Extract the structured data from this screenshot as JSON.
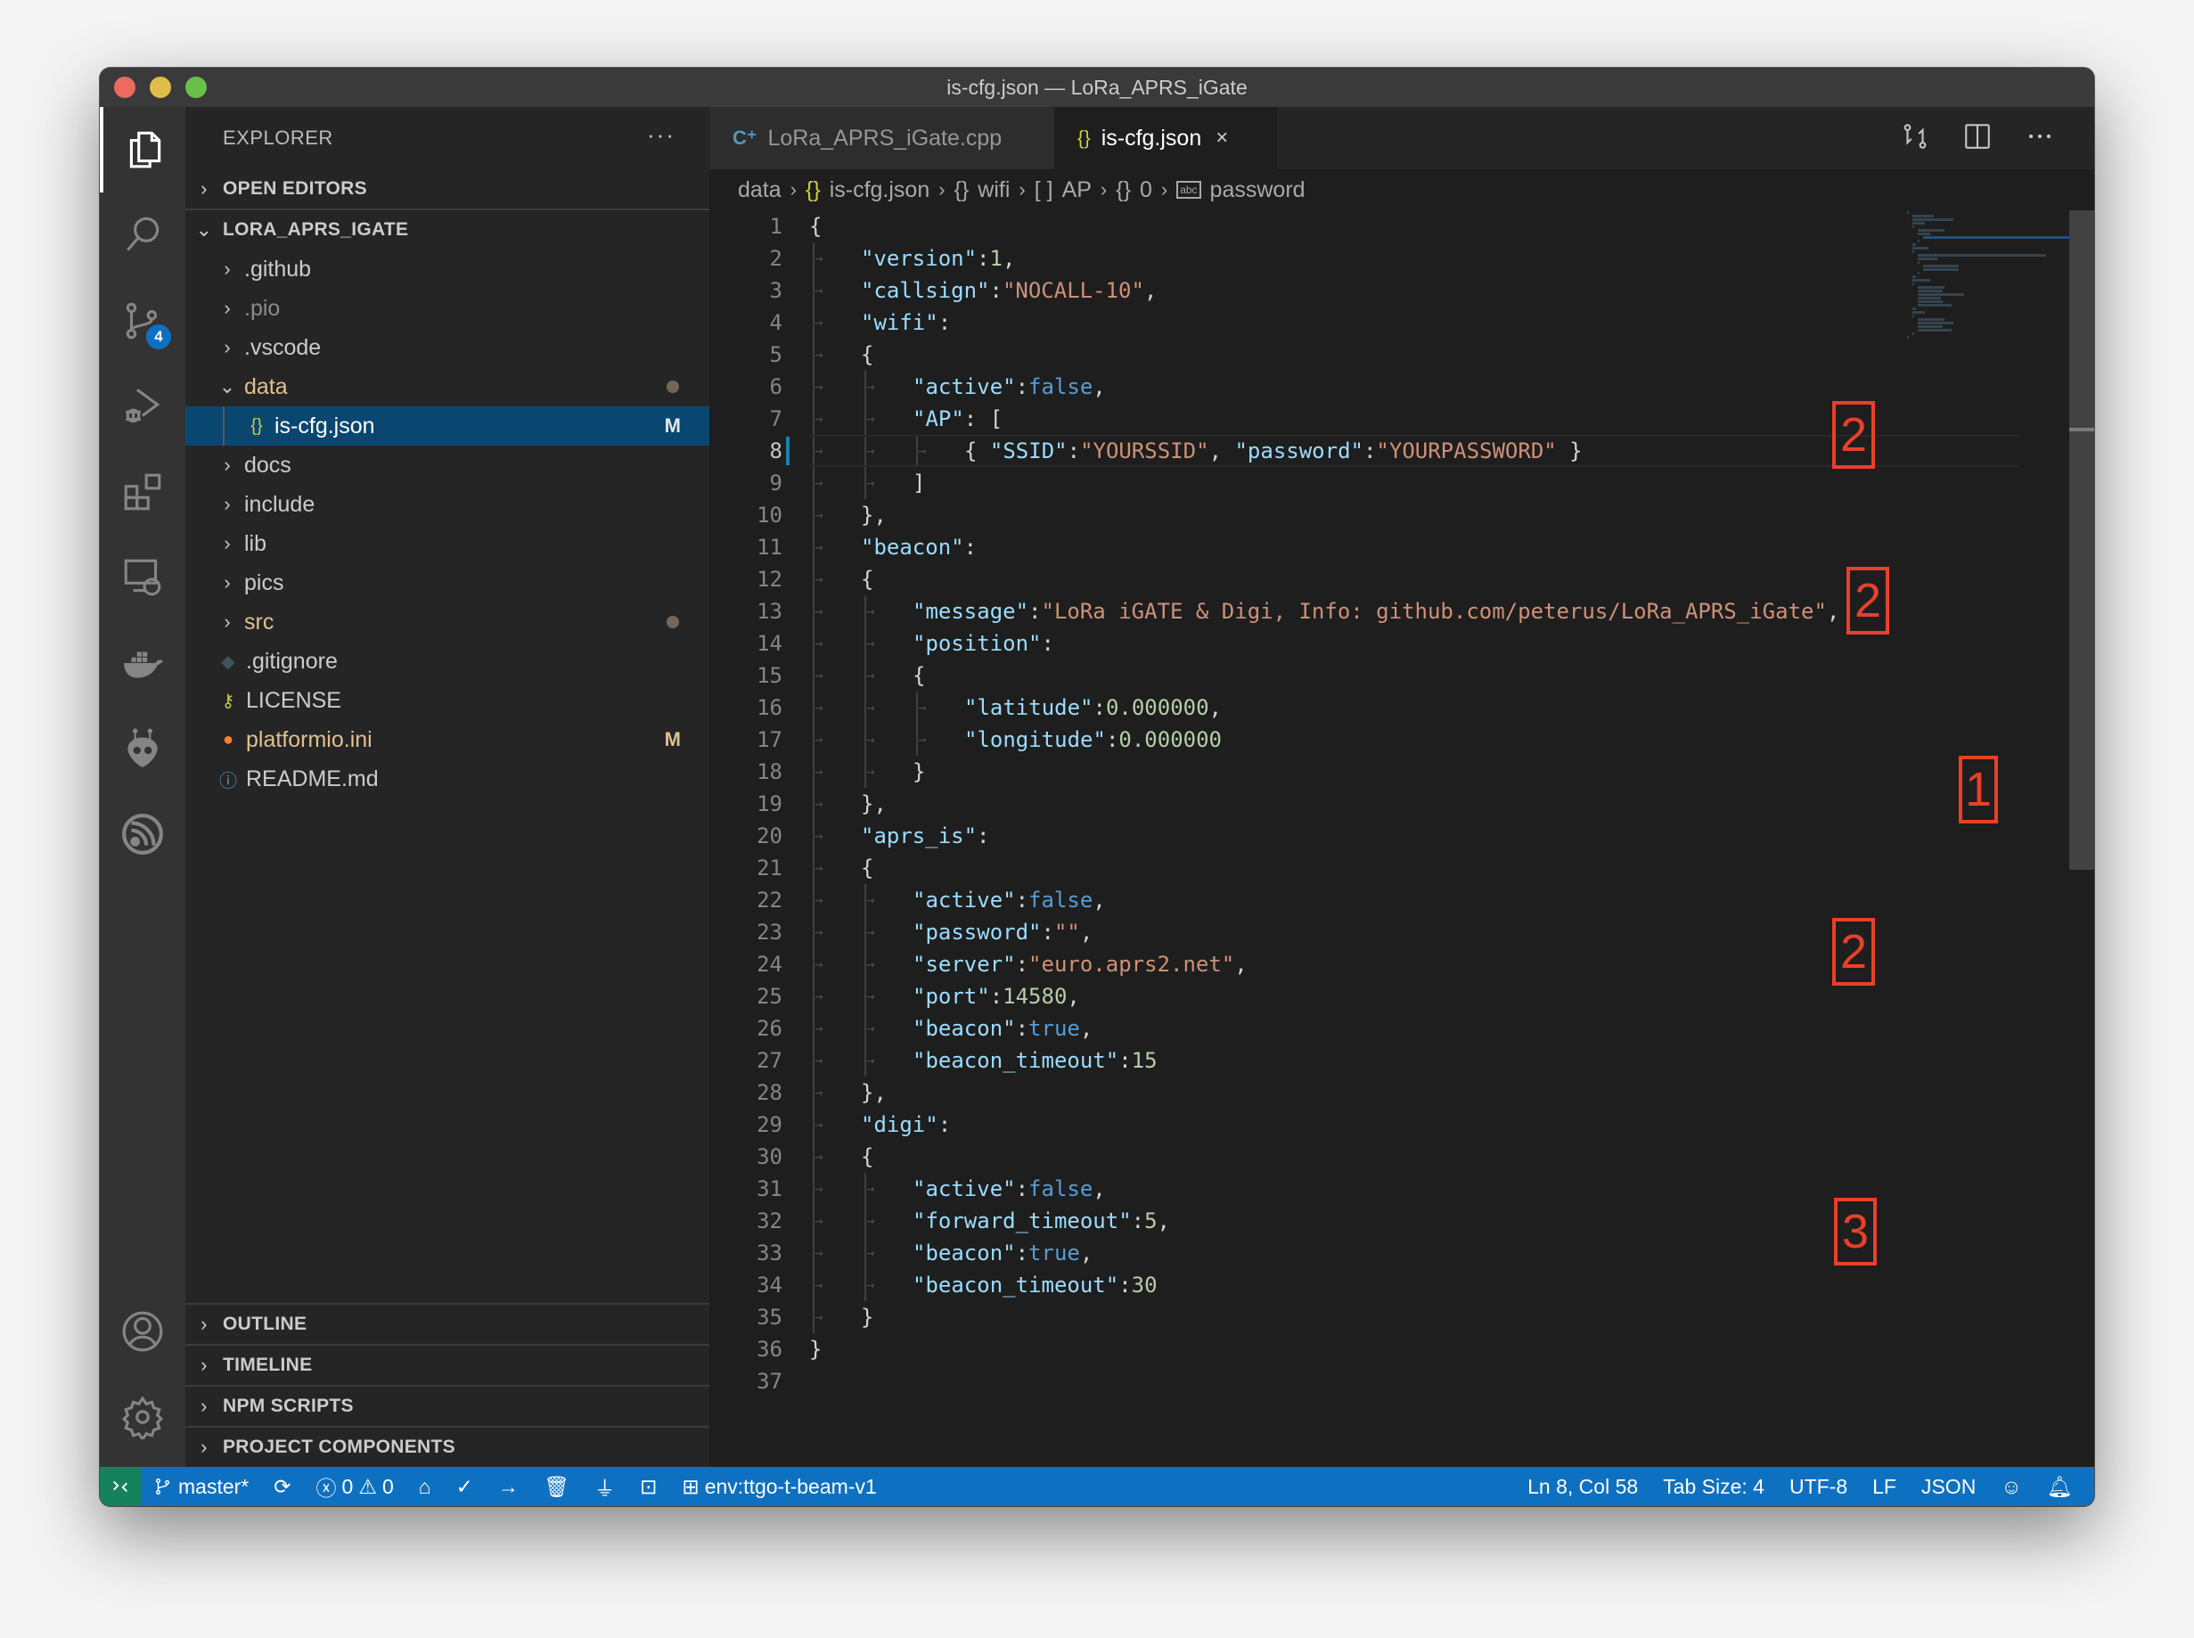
{
  "window": {
    "title": "is-cfg.json — LoRa_APRS_iGate"
  },
  "activity_bar": {
    "items": [
      {
        "name": "explorer",
        "icon": "files-icon",
        "active": true
      },
      {
        "name": "search",
        "icon": "search-icon"
      },
      {
        "name": "source-control",
        "icon": "source-control-icon",
        "badge": "4"
      },
      {
        "name": "run-debug",
        "icon": "run-debug-icon"
      },
      {
        "name": "extensions",
        "icon": "extensions-icon"
      },
      {
        "name": "remote-explorer",
        "icon": "remote-explorer-icon"
      },
      {
        "name": "docker",
        "icon": "docker-icon"
      },
      {
        "name": "platformio",
        "icon": "platformio-icon"
      },
      {
        "name": "espressif",
        "icon": "espressif-icon"
      }
    ],
    "bottom": [
      {
        "name": "accounts",
        "icon": "account-icon"
      },
      {
        "name": "manage",
        "icon": "gear-icon"
      }
    ]
  },
  "sidebar": {
    "title": "EXPLORER",
    "more": "···",
    "open_editors": "OPEN EDITORS",
    "project": "LORA_APRS_IGATE",
    "tree": [
      {
        "label": ".github",
        "type": "folder",
        "expanded": false
      },
      {
        "label": ".pio",
        "type": "folder",
        "expanded": false,
        "dimmed": true
      },
      {
        "label": ".vscode",
        "type": "folder",
        "expanded": false
      },
      {
        "label": "data",
        "type": "folder",
        "expanded": true,
        "modified": true
      },
      {
        "label": "is-cfg.json",
        "type": "file",
        "icon": "{}",
        "selected": true,
        "decoration": "M"
      },
      {
        "label": "docs",
        "type": "folder",
        "expanded": false
      },
      {
        "label": "include",
        "type": "folder",
        "expanded": false
      },
      {
        "label": "lib",
        "type": "folder",
        "expanded": false
      },
      {
        "label": "pics",
        "type": "folder",
        "expanded": false
      },
      {
        "label": "src",
        "type": "folder",
        "expanded": false,
        "modified": true
      },
      {
        "label": ".gitignore",
        "type": "file",
        "icon": "git-icon"
      },
      {
        "label": "LICENSE",
        "type": "file",
        "icon": "license-key-icon"
      },
      {
        "label": "platformio.ini",
        "type": "file",
        "icon": "platformio-file-icon",
        "decoration": "M",
        "modified": true
      },
      {
        "label": "README.md",
        "type": "file",
        "icon": "info-icon"
      }
    ],
    "sections": [
      "OUTLINE",
      "TIMELINE",
      "NPM SCRIPTS",
      "PROJECT COMPONENTS"
    ]
  },
  "tabs": [
    {
      "label": "LoRa_APRS_iGate.cpp",
      "icon": "C++",
      "active": false
    },
    {
      "label": "is-cfg.json",
      "icon": "{}",
      "active": true,
      "close": "×"
    }
  ],
  "breadcrumb": {
    "items": [
      {
        "label": "data",
        "icon": ""
      },
      {
        "label": "is-cfg.json",
        "icon": "{}"
      },
      {
        "label": "wifi",
        "icon": "{}"
      },
      {
        "label": "AP",
        "icon": "[ ]"
      },
      {
        "label": "0",
        "icon": "{}"
      },
      {
        "label": "password",
        "icon": "abc"
      }
    ],
    "separator": "›"
  },
  "editor": {
    "current_line": 8,
    "lines": [
      [
        {
          "t": "p",
          "v": "{"
        }
      ],
      [
        {
          "t": "k",
          "v": "\"version\""
        },
        {
          "t": "p",
          "v": ":"
        },
        {
          "t": "n",
          "v": "1"
        },
        {
          "t": "p",
          "v": ","
        }
      ],
      [
        {
          "t": "k",
          "v": "\"callsign\""
        },
        {
          "t": "p",
          "v": ":"
        },
        {
          "t": "s",
          "v": "\"NOCALL-10\""
        },
        {
          "t": "p",
          "v": ","
        }
      ],
      [
        {
          "t": "k",
          "v": "\"wifi\""
        },
        {
          "t": "p",
          "v": ":"
        }
      ],
      [
        {
          "t": "p",
          "v": "{"
        }
      ],
      [
        {
          "t": "k",
          "v": "\"active\""
        },
        {
          "t": "p",
          "v": ":"
        },
        {
          "t": "b",
          "v": "false"
        },
        {
          "t": "p",
          "v": ","
        }
      ],
      [
        {
          "t": "k",
          "v": "\"AP\""
        },
        {
          "t": "p",
          "v": ": ["
        }
      ],
      [
        {
          "t": "p",
          "v": "{ "
        },
        {
          "t": "k",
          "v": "\"SSID\""
        },
        {
          "t": "p",
          "v": ":"
        },
        {
          "t": "s",
          "v": "\"YOURSSID\""
        },
        {
          "t": "p",
          "v": ", "
        },
        {
          "t": "k",
          "v": "\"password\""
        },
        {
          "t": "p",
          "v": ":"
        },
        {
          "t": "s",
          "v": "\"YOURPASSWORD\""
        },
        {
          "t": "p",
          "v": " }"
        }
      ],
      [
        {
          "t": "p",
          "v": "]"
        }
      ],
      [
        {
          "t": "p",
          "v": "},"
        }
      ],
      [
        {
          "t": "k",
          "v": "\"beacon\""
        },
        {
          "t": "p",
          "v": ":"
        }
      ],
      [
        {
          "t": "p",
          "v": "{"
        }
      ],
      [
        {
          "t": "k",
          "v": "\"message\""
        },
        {
          "t": "p",
          "v": ":"
        },
        {
          "t": "s",
          "v": "\"LoRa iGATE & Digi, Info: github.com/peterus/LoRa_APRS_iGate\""
        },
        {
          "t": "p",
          "v": ","
        }
      ],
      [
        {
          "t": "k",
          "v": "\"position\""
        },
        {
          "t": "p",
          "v": ":"
        }
      ],
      [
        {
          "t": "p",
          "v": "{"
        }
      ],
      [
        {
          "t": "k",
          "v": "\"latitude\""
        },
        {
          "t": "p",
          "v": ":"
        },
        {
          "t": "n",
          "v": "0.000000"
        },
        {
          "t": "p",
          "v": ","
        }
      ],
      [
        {
          "t": "k",
          "v": "\"longitude\""
        },
        {
          "t": "p",
          "v": ":"
        },
        {
          "t": "n",
          "v": "0.000000"
        }
      ],
      [
        {
          "t": "p",
          "v": "}"
        }
      ],
      [
        {
          "t": "p",
          "v": "},"
        }
      ],
      [
        {
          "t": "k",
          "v": "\"aprs_is\""
        },
        {
          "t": "p",
          "v": ":"
        }
      ],
      [
        {
          "t": "p",
          "v": "{"
        }
      ],
      [
        {
          "t": "k",
          "v": "\"active\""
        },
        {
          "t": "p",
          "v": ":"
        },
        {
          "t": "b",
          "v": "false"
        },
        {
          "t": "p",
          "v": ","
        }
      ],
      [
        {
          "t": "k",
          "v": "\"password\""
        },
        {
          "t": "p",
          "v": ":"
        },
        {
          "t": "s",
          "v": "\"\""
        },
        {
          "t": "p",
          "v": ","
        }
      ],
      [
        {
          "t": "k",
          "v": "\"server\""
        },
        {
          "t": "p",
          "v": ":"
        },
        {
          "t": "s",
          "v": "\"euro.aprs2.net\""
        },
        {
          "t": "p",
          "v": ","
        }
      ],
      [
        {
          "t": "k",
          "v": "\"port\""
        },
        {
          "t": "p",
          "v": ":"
        },
        {
          "t": "n",
          "v": "14580"
        },
        {
          "t": "p",
          "v": ","
        }
      ],
      [
        {
          "t": "k",
          "v": "\"beacon\""
        },
        {
          "t": "p",
          "v": ":"
        },
        {
          "t": "b",
          "v": "true"
        },
        {
          "t": "p",
          "v": ","
        }
      ],
      [
        {
          "t": "k",
          "v": "\"beacon_timeout\""
        },
        {
          "t": "p",
          "v": ":"
        },
        {
          "t": "n",
          "v": "15"
        }
      ],
      [
        {
          "t": "p",
          "v": "},"
        }
      ],
      [
        {
          "t": "k",
          "v": "\"digi\""
        },
        {
          "t": "p",
          "v": ":"
        }
      ],
      [
        {
          "t": "p",
          "v": "{"
        }
      ],
      [
        {
          "t": "k",
          "v": "\"active\""
        },
        {
          "t": "p",
          "v": ":"
        },
        {
          "t": "b",
          "v": "false"
        },
        {
          "t": "p",
          "v": ","
        }
      ],
      [
        {
          "t": "k",
          "v": "\"forward_timeout\""
        },
        {
          "t": "p",
          "v": ":"
        },
        {
          "t": "n",
          "v": "5"
        },
        {
          "t": "p",
          "v": ","
        }
      ],
      [
        {
          "t": "k",
          "v": "\"beacon\""
        },
        {
          "t": "p",
          "v": ":"
        },
        {
          "t": "b",
          "v": "true"
        },
        {
          "t": "p",
          "v": ","
        }
      ],
      [
        {
          "t": "k",
          "v": "\"beacon_timeout\""
        },
        {
          "t": "p",
          "v": ":"
        },
        {
          "t": "n",
          "v": "30"
        }
      ],
      [
        {
          "t": "p",
          "v": "}"
        }
      ],
      [
        {
          "t": "p",
          "v": "}"
        }
      ],
      []
    ],
    "indents": [
      0,
      1,
      1,
      1,
      1,
      2,
      2,
      3,
      2,
      1,
      1,
      1,
      2,
      2,
      2,
      3,
      3,
      2,
      1,
      1,
      1,
      2,
      2,
      2,
      2,
      2,
      2,
      1,
      1,
      1,
      2,
      2,
      2,
      2,
      1,
      0,
      0
    ]
  },
  "annotations": [
    {
      "label": "2",
      "near": "wifi.active"
    },
    {
      "label": "2",
      "near": "wifi.AP.SSID"
    },
    {
      "label": "2",
      "near": "wifi.AP.password"
    },
    {
      "label": "1",
      "near": "beacon.position"
    },
    {
      "label": "2",
      "near": "aprs_is.active"
    },
    {
      "label": "3",
      "near": "digi.active"
    }
  ],
  "statusbar": {
    "branch": "master*",
    "errors": "0",
    "warnings": "0",
    "env": "env:ttgo-t-beam-v1",
    "cursor": "Ln 8, Col 58",
    "tab_size": "Tab Size: 4",
    "encoding": "UTF-8",
    "eol": "LF",
    "language": "JSON"
  },
  "colors": {
    "accent": "#0e70c0",
    "remote": "#16825d",
    "annotation": "#e8402a",
    "json_key": "#9cdcfe",
    "json_string": "#ce9178",
    "json_number": "#b5cea8",
    "json_bool": "#569cd6"
  }
}
